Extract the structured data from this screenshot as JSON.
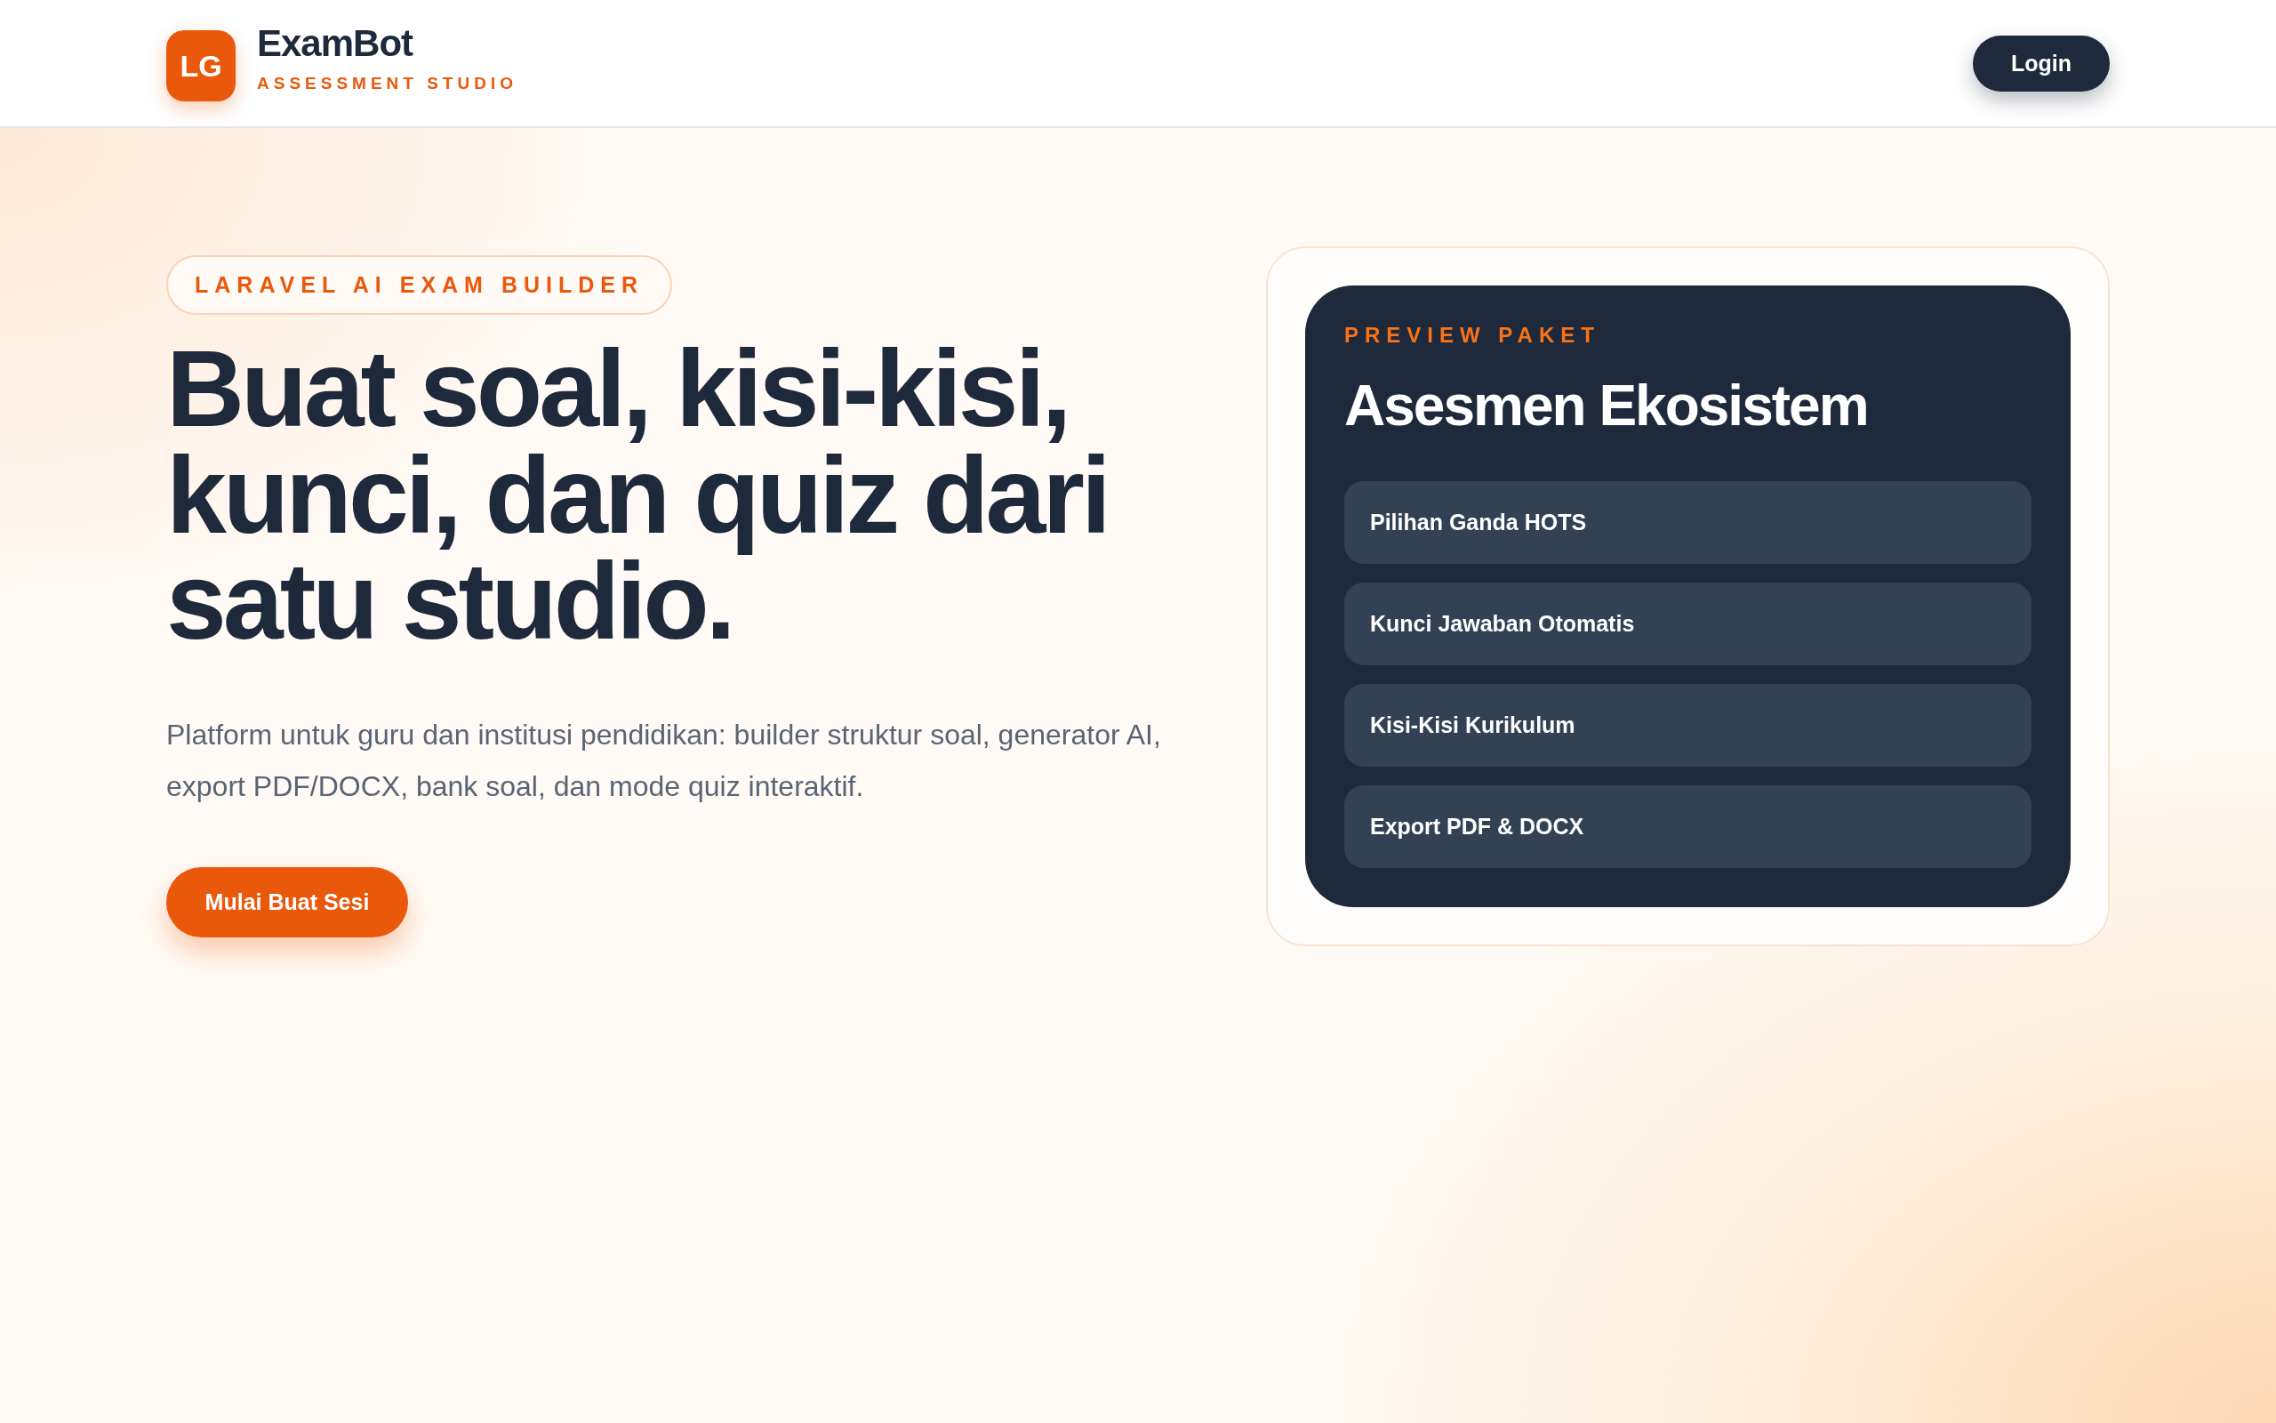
{
  "header": {
    "logo_text": "LG",
    "brand": "ExamBot",
    "tagline": "ASSESSMENT STUDIO",
    "login": "Login"
  },
  "hero": {
    "badge": "LARAVEL AI EXAM BUILDER",
    "title": "Buat soal, kisi-kisi, kunci, dan quiz dari satu studio.",
    "description": "Platform untuk guru dan institusi pendidikan: builder struktur soal, generator AI, export PDF/DOCX, bank soal, dan mode quiz interaktif.",
    "cta": "Mulai Buat Sesi"
  },
  "preview": {
    "label": "PREVIEW PAKET",
    "title": "Asesmen Ekosistem",
    "items": [
      "Pilihan Ganda HOTS",
      "Kunci Jawaban Otomatis",
      "Kisi-Kisi Kurikulum",
      "Export PDF & DOCX"
    ]
  }
}
